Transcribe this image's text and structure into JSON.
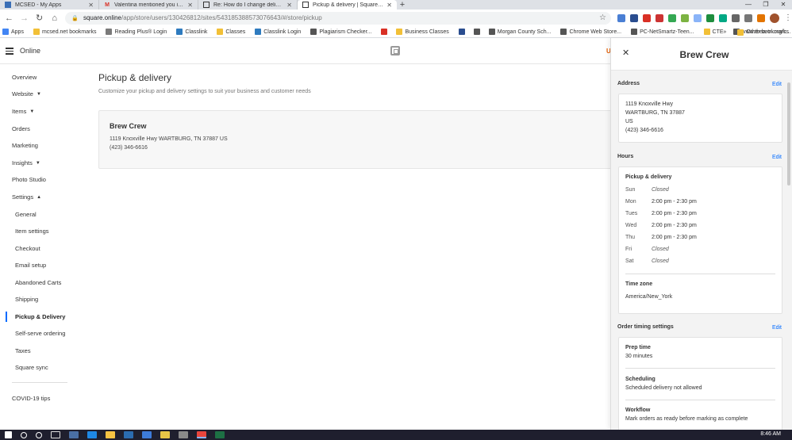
{
  "browser": {
    "tabs": [
      {
        "title": "MCSED - My Apps",
        "icon_color": "#3b6fb6",
        "active": false
      },
      {
        "title": "Valentina mentioned you in the",
        "icon_color": "#d93025",
        "active": false
      },
      {
        "title": "Re: How do I change delivery da",
        "icon_color": "#333333",
        "active": false
      },
      {
        "title": "Pickup & delivery | Square Onlin",
        "icon_color": "#333333",
        "active": true
      }
    ],
    "new_tab": "+",
    "url_host": "square.online",
    "url_path": "/app/store/users/130426812/sites/543185388573076643/#/store/pickup",
    "bookmarks": [
      {
        "label": "Apps",
        "color": "#4285f4"
      },
      {
        "label": "mcsed.net bookmarks",
        "color": "#f2c037"
      },
      {
        "label": "Reading Plus® Login",
        "color": "#7a7a7a"
      },
      {
        "label": "Classlink",
        "color": "#2e7bbf"
      },
      {
        "label": "Classes",
        "color": "#f2c037"
      },
      {
        "label": "Classlink Login",
        "color": "#2e7bbf"
      },
      {
        "label": "Plagiarism Checker...",
        "color": "#555555"
      },
      {
        "label": "",
        "color": "#d93025"
      },
      {
        "label": "Business Classes",
        "color": "#f2c037"
      },
      {
        "label": "",
        "color": "#2a4d8f"
      },
      {
        "label": "",
        "color": "#555555"
      },
      {
        "label": "Morgan County Sch...",
        "color": "#555555"
      },
      {
        "label": "Chrome Web Store...",
        "color": "#555555"
      },
      {
        "label": "PC-NetSmartz-Teen...",
        "color": "#555555"
      },
      {
        "label": "CTE",
        "color": "#f2c037"
      },
      {
        "label": "www.tbea-tn.org/c...",
        "color": "#555555"
      }
    ],
    "bookmarks_more": "»",
    "other_bookmarks": "Other bookmarks"
  },
  "app": {
    "brand": "Online",
    "user_initial": "U"
  },
  "sidebar": {
    "items": [
      {
        "label": "Overview",
        "chevron": ""
      },
      {
        "label": "Website",
        "chevron": "down"
      },
      {
        "label": "Items",
        "chevron": "down"
      },
      {
        "label": "Orders",
        "chevron": ""
      },
      {
        "label": "Marketing",
        "chevron": ""
      },
      {
        "label": "Insights",
        "chevron": "down"
      },
      {
        "label": "Photo Studio",
        "chevron": ""
      },
      {
        "label": "Settings",
        "chevron": "up"
      }
    ],
    "settings_sub": [
      "General",
      "Item settings",
      "Checkout",
      "Email setup",
      "Abandoned Carts",
      "Shipping",
      "Pickup & Delivery",
      "Self-serve ordering",
      "Taxes",
      "Square sync"
    ],
    "active_sub": "Pickup & Delivery",
    "footer_item": "COVID-19 tips"
  },
  "main": {
    "title": "Pickup & delivery",
    "subtitle": "Customize your pickup and delivery settings to suit your business and customer needs",
    "store": {
      "name": "Brew Crew",
      "address": "1119 Knoxville Hwy WARTBURG, TN 37887 US",
      "phone": "(423) 346-6616"
    }
  },
  "panel": {
    "title": "Brew Crew",
    "address": {
      "label": "Address",
      "edit": "Edit",
      "lines": [
        "1119 Knoxville Hwy",
        "WARTBURG, TN 37887",
        "US",
        "(423) 346-6616"
      ]
    },
    "hours": {
      "label": "Hours",
      "edit": "Edit",
      "heading": "Pickup & delivery",
      "days": [
        {
          "day": "Sun",
          "time": "Closed",
          "closed": true
        },
        {
          "day": "Mon",
          "time": "2:00 pm - 2:30 pm",
          "closed": false
        },
        {
          "day": "Tues",
          "time": "2:00 pm - 2:30 pm",
          "closed": false
        },
        {
          "day": "Wed",
          "time": "2:00 pm - 2:30 pm",
          "closed": false
        },
        {
          "day": "Thu",
          "time": "2:00 pm - 2:30 pm",
          "closed": false
        },
        {
          "day": "Fri",
          "time": "Closed",
          "closed": true
        },
        {
          "day": "Sat",
          "time": "Closed",
          "closed": true
        }
      ],
      "timezone_label": "Time zone",
      "timezone": "America/New_York"
    },
    "order_timing": {
      "label": "Order timing settings",
      "edit": "Edit",
      "prep_label": "Prep time",
      "prep_value": "30 minutes",
      "scheduling_label": "Scheduling",
      "scheduling_value": "Scheduled delivery not allowed",
      "workflow_label": "Workflow",
      "workflow_value": "Mark orders as ready before marking as complete"
    }
  },
  "taskbar": {
    "time": "8:46 AM"
  }
}
